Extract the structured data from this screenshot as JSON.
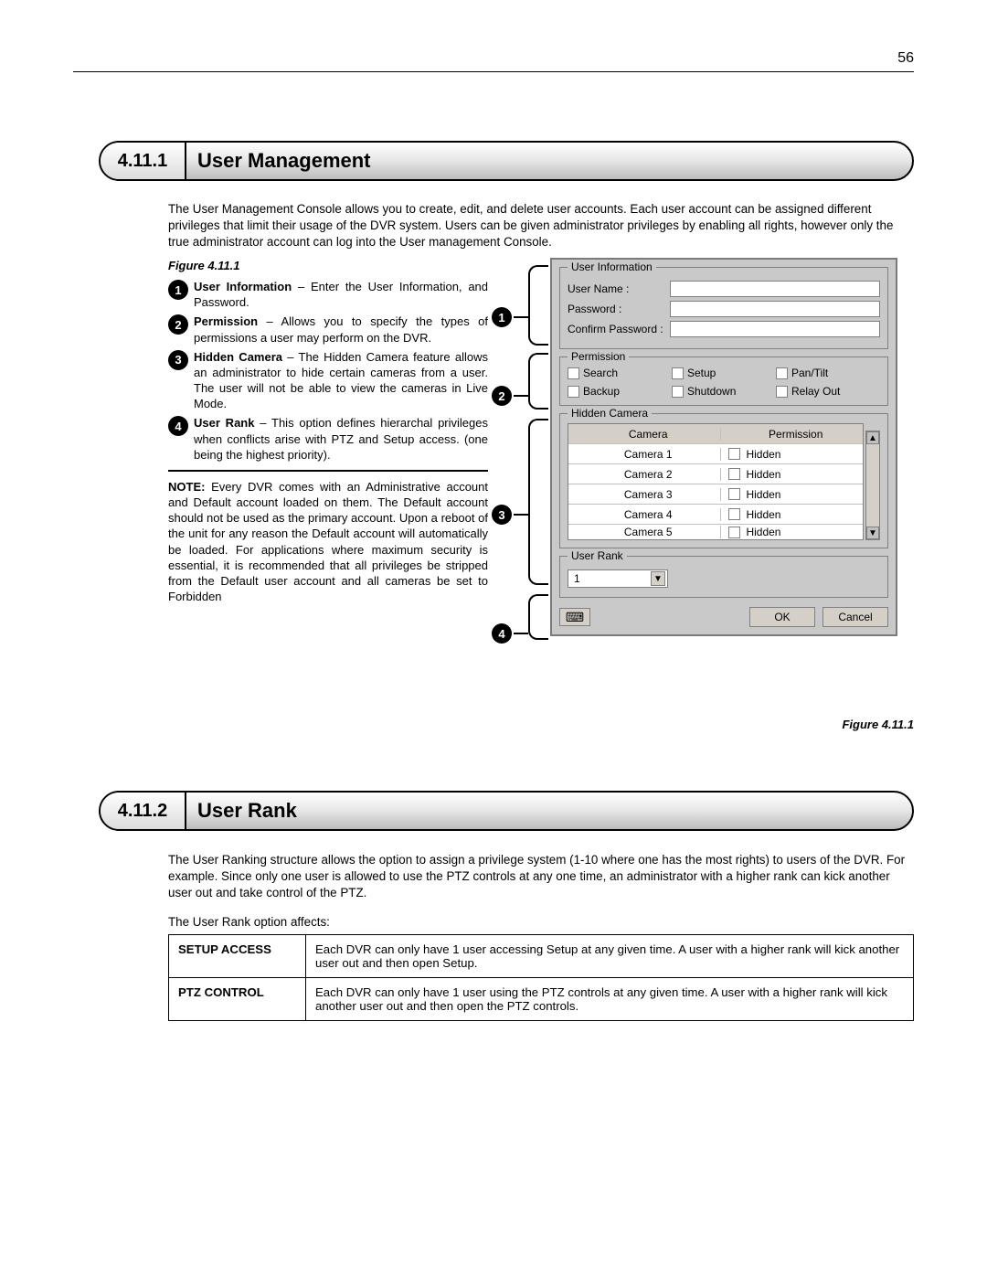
{
  "page_number": "56",
  "section1": {
    "number": "4.11.1",
    "title": "User Management",
    "intro": "The User Management Console allows you to create, edit, and delete user accounts. Each user account can be assigned different privileges that limit their usage of the DVR system. Users can be given administrator privileges by enabling all rights, however only the true administrator account can log into the User management Console.",
    "figure_label_top": "Figure 4.11.1",
    "defs": [
      {
        "term": "User Information",
        "text": " – Enter the User Information, and Password."
      },
      {
        "term": "Permission",
        "text": " – Allows you to specify the types of permissions a user may perform on the DVR."
      },
      {
        "term": "Hidden Camera",
        "text": " – The Hidden Camera feature allows an administrator to hide certain cameras from a user. The user will not be able to view the cameras in Live Mode."
      },
      {
        "term": "User Rank",
        "text": " – This option defines hierarchal privileges when conflicts arise with PTZ and Setup access.  (one being the highest priority)."
      }
    ],
    "note_label": "NOTE:",
    "note_text": " Every DVR comes with an Administrative account and Default account loaded on them. The Default account should not be used as the primary account. Upon a reboot of the unit for any reason the Default account will automatically be loaded. For applications where maximum security is essential, it is recommended that all privileges be stripped from the Default user account and all cameras be set to Forbidden",
    "figure_label_bottom": "Figure 4.11.1"
  },
  "dialog": {
    "group_user_info": {
      "legend": "User Information",
      "username_label": "User Name :",
      "password_label": "Password :",
      "confirm_label": "Confirm Password :"
    },
    "group_permission": {
      "legend": "Permission",
      "items": [
        "Search",
        "Setup",
        "Pan/Tilt",
        "Backup",
        "Shutdown",
        "Relay Out"
      ]
    },
    "group_hidden": {
      "legend": "Hidden Camera",
      "col_camera": "Camera",
      "col_permission": "Permission",
      "rows": [
        {
          "camera": "Camera 1",
          "perm": "Hidden"
        },
        {
          "camera": "Camera 2",
          "perm": "Hidden"
        },
        {
          "camera": "Camera 3",
          "perm": "Hidden"
        },
        {
          "camera": "Camera 4",
          "perm": "Hidden"
        },
        {
          "camera": "Camera 5",
          "perm": "Hidden"
        }
      ]
    },
    "group_rank": {
      "legend": "User Rank",
      "value": "1"
    },
    "buttons": {
      "ok": "OK",
      "cancel": "Cancel"
    }
  },
  "section2": {
    "number": "4.11.2",
    "title": "User Rank",
    "intro": "The User Ranking structure allows the option to assign a privilege system (1-10 where one has the most rights) to users of the DVR.  For example.  Since only one user is allowed to use the PTZ controls at any one time, an administrator with a higher rank can kick another user out and take control of the PTZ.",
    "affects_line": "The User Rank option affects:",
    "rows": [
      {
        "key": "SETUP ACCESS",
        "val": "Each DVR can only have 1 user accessing Setup at any given time.  A user with a higher rank will kick another user out and then open Setup."
      },
      {
        "key": "PTZ CONTROL",
        "val": "Each DVR can only have 1 user using the PTZ controls at any given time.  A user with a higher rank will kick another user out and then open the PTZ controls."
      }
    ]
  }
}
